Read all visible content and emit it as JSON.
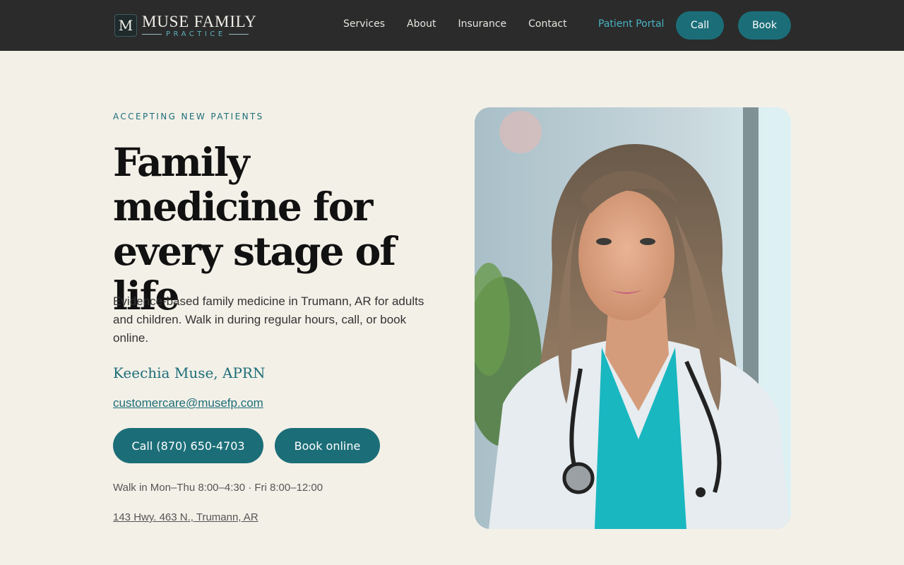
{
  "header": {
    "logo_mark": "M",
    "logo_title": "MUSE FAMILY",
    "logo_sub": "PRACTICE",
    "nav": [
      "Services",
      "About",
      "Insurance",
      "Contact"
    ],
    "portal_label": "Patient Portal",
    "call_label": "Call",
    "book_label": "Book"
  },
  "hero": {
    "eyebrow": "ACCEPTING NEW PATIENTS",
    "headline": "Family medicine for every stage of life",
    "lede": "Evidence-based family medicine in Trumann, AR for adults and children. Walk in during regular hours, call, or book online.",
    "doctor": "Keechia Muse, APRN",
    "email": "customercare@musefp.com",
    "call_button": "Call (870) 650-4703",
    "book_button": "Book online",
    "hours": "Walk in Mon–Thu 8:00–4:30 · Fri 8:00–12:00",
    "address": "143 Hwy. 463 N., Trumann, AR"
  },
  "colors": {
    "accent": "#1b6e78",
    "header_bg": "#2b2b2b",
    "page_bg": "#f3f0e8",
    "portal_link": "#49b3c2"
  }
}
